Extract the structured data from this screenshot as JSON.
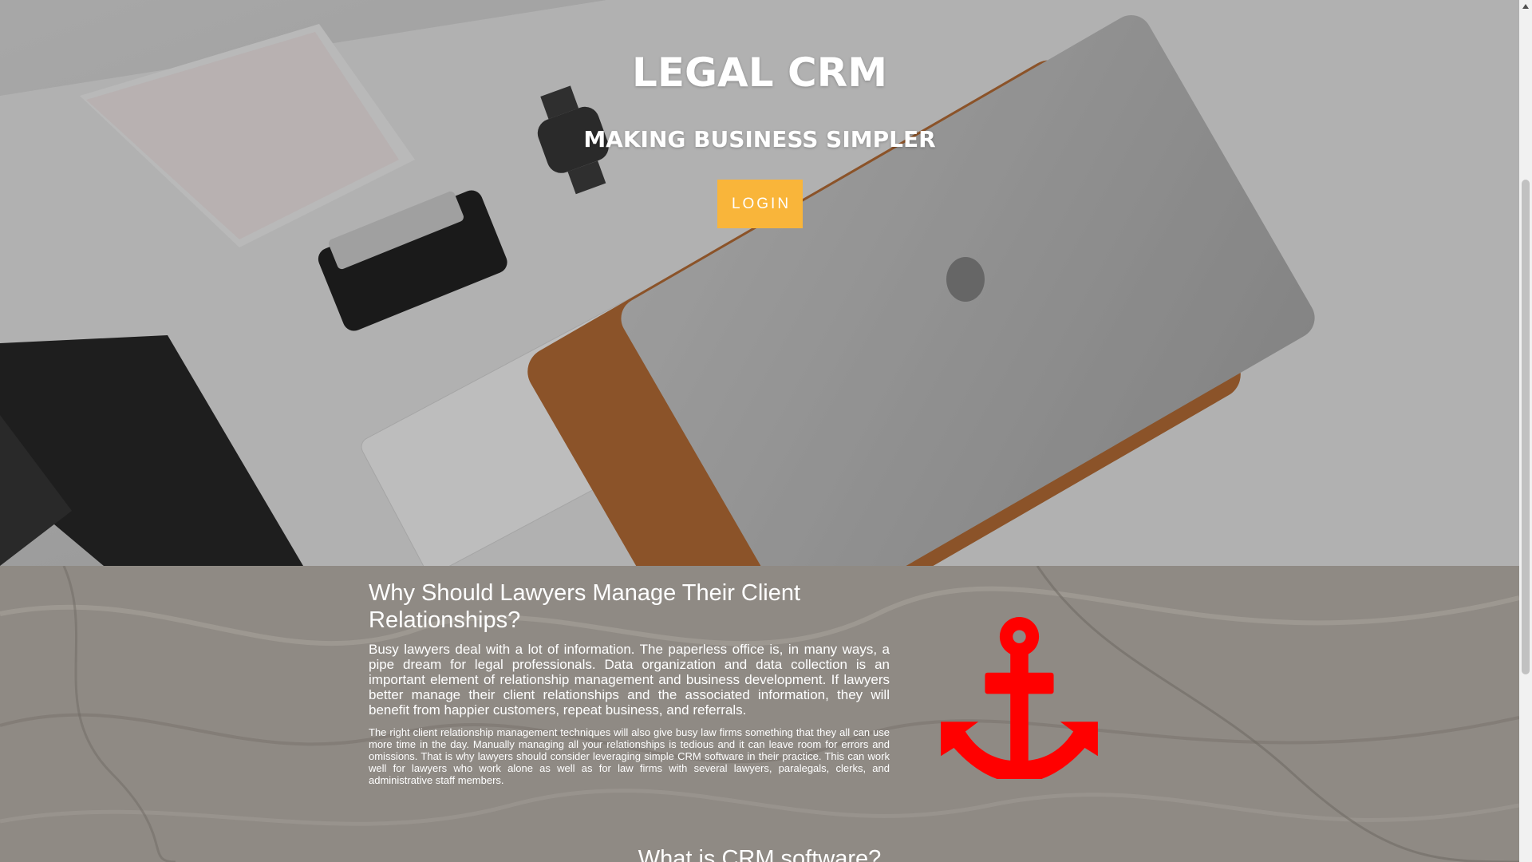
{
  "hero": {
    "title": "LEGAL CRM",
    "subtitle": "MAKING BUSINESS SIMPLER",
    "login_label": "LOGIN",
    "login_color": "#f9b53a",
    "background": "desk-photo-image"
  },
  "why": {
    "heading": "Why Should Lawyers Manage Their Client Relationships?",
    "paragraph_1": "Busy lawyers deal with a lot of information. The paperless office is, in many ways, a pipe dream for legal professionals. Data organization and data collection is an important element of relationship management and business development. If lawyers better manage their client relationships and the associated information, they will benefit from happier customers, repeat business, and referrals.",
    "paragraph_2": "The right client relationship management techniques will also give busy law firms something that they all can use more time in the day. Manually managing all your relationships is tedious and it can leave room for errors and omissions. That is why lawyers should consider leveraging simple CRM software in their practice. This can work well for lawyers who work alone as well as for law firms with several lawyers, paralegals, clerks, and administrative staff members.",
    "icon": "anchor-icon",
    "icon_color": "#ff0000"
  },
  "crm": {
    "heading": "What is CRM software?"
  },
  "scrollbar": {
    "icon": "chevron-up-icon"
  }
}
